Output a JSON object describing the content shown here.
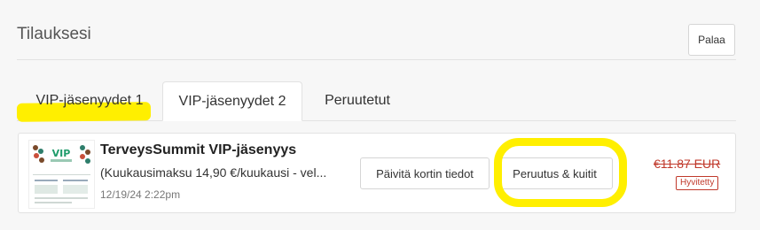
{
  "header": {
    "title": "Tilauksesi",
    "back_label": "Palaa"
  },
  "tabs": [
    {
      "label": "VIP-jäsenyydet 1",
      "active": false
    },
    {
      "label": "VIP-jäsenyydet 2",
      "active": true
    },
    {
      "label": "Peruutetut",
      "active": false
    }
  ],
  "order": {
    "thumbnail_text": "VIP",
    "name": "TerveysSummit VIP-jäsenyys",
    "description": "(Kuukausimaksu 14,90 €/kuukausi - vel...",
    "date": "12/19/24 2:22pm",
    "update_card_label": "Päivitä kortin tiedot",
    "cancel_receipts_label": "Peruutus & kuitit",
    "price": "€11.87 EUR",
    "status_badge": "Hyvitetty"
  },
  "colors": {
    "highlight": "#ffef00",
    "refund_red": "#c0392b"
  }
}
